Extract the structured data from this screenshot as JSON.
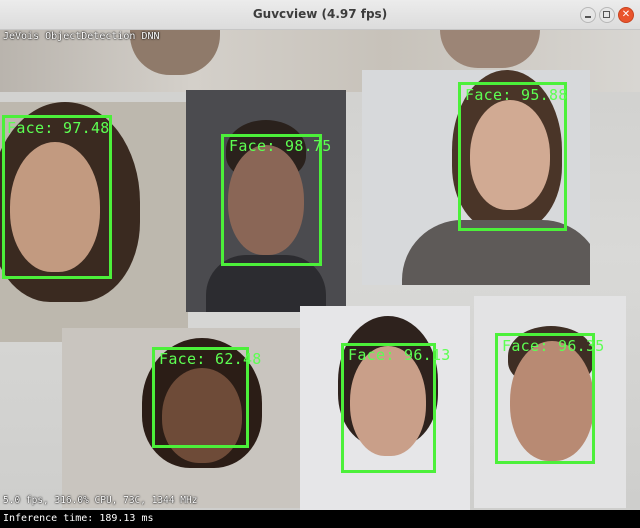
{
  "window": {
    "title": "Guvcview (4.97 fps)",
    "buttons": [
      "minimize-icon",
      "maximize-icon",
      "close-icon"
    ]
  },
  "overlay": {
    "model_label": "JeVois ObjectDetection DNN",
    "stats": "5.0 fps, 316.0% CPU, 73C, 1344 MHz",
    "inference": "Inference time: 189.13 ms"
  },
  "detections": [
    {
      "label": "Face: 97.48",
      "confidence": 97.48
    },
    {
      "label": "Face: 98.75",
      "confidence": 98.75
    },
    {
      "label": "Face: 95.88",
      "confidence": 95.88
    },
    {
      "label": "Face: 62.48",
      "confidence": 62.48
    },
    {
      "label": "Face: 96.13",
      "confidence": 96.13
    },
    {
      "label": "Face: 96.35",
      "confidence": 96.35
    }
  ],
  "colors": {
    "box": "#4cf03a",
    "label": "#5dff52",
    "close_button": "#e9542c"
  }
}
